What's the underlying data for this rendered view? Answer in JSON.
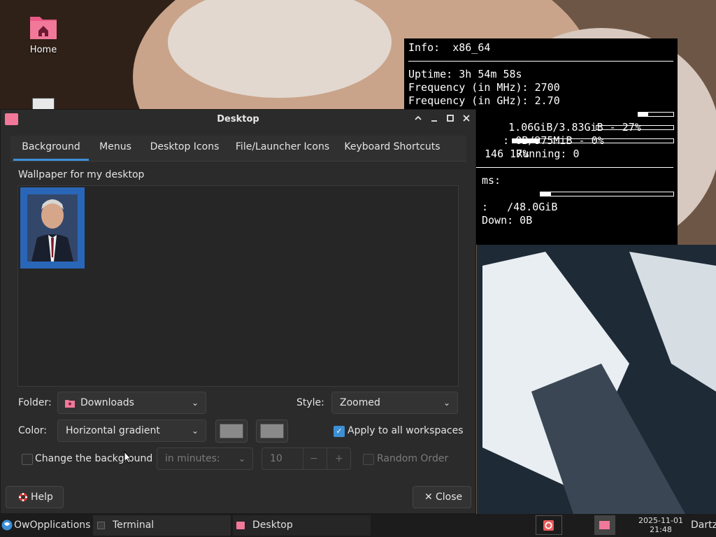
{
  "desktop": {
    "home_label": "Home"
  },
  "conky": {
    "info": "Info:  x86_64",
    "uptime": "Uptime: 3h 54m 58s",
    "freq_mhz": "Frequency (in MHz): 2700",
    "freq_ghz": "Frequency (in GHz): 2.70",
    "ram": " 1.06GiB/3.83GiB - 27%",
    "ram_fraction": 0.27,
    "swap": " : 0B/975MiB - 0%",
    "swap_fraction": 0.0,
    "cpu": " 17%",
    "cpu_fraction": 0.17,
    "processes": " 146  Running: 0",
    "fs_label": "ms:",
    "fs_usage": "/48.0GiB",
    "fs_fraction": 0.08,
    "net_label": ":",
    "net_down": "Down: 0B"
  },
  "window": {
    "title": "Desktop",
    "tabs": [
      "Background",
      "Menus",
      "Desktop Icons",
      "File/Launcher Icons",
      "Keyboard Shortcuts"
    ],
    "active_tab": "Background",
    "wallpaper_label": "Wallpaper for my desktop",
    "folder_label": "Folder:",
    "folder_value": "Downloads",
    "style_label": "Style:",
    "style_value": "Zoomed",
    "color_label": "Color:",
    "color_value": "Horizontal gradient",
    "apply_all_label": "Apply to all workspaces",
    "apply_all_checked": true,
    "change_bg_label": "Change the background",
    "change_bg_checked": false,
    "interval_value": "in minutes:",
    "minutes_value": "10",
    "minus_label": "−",
    "plus_label": "+",
    "random_label": "Random Order",
    "random_checked": false,
    "help_label": "Help",
    "close_label": "Close"
  },
  "taskbar": {
    "menu_label": "OwOpplications",
    "tasks": [
      "Terminal",
      "Desktop"
    ],
    "date": "2025-11-01",
    "time": "21:48",
    "user": "Dartz"
  },
  "colors": {
    "accent": "#3d8fd6",
    "thumb_selection": "#2a66b8",
    "folder_icon": "#f2789a"
  }
}
